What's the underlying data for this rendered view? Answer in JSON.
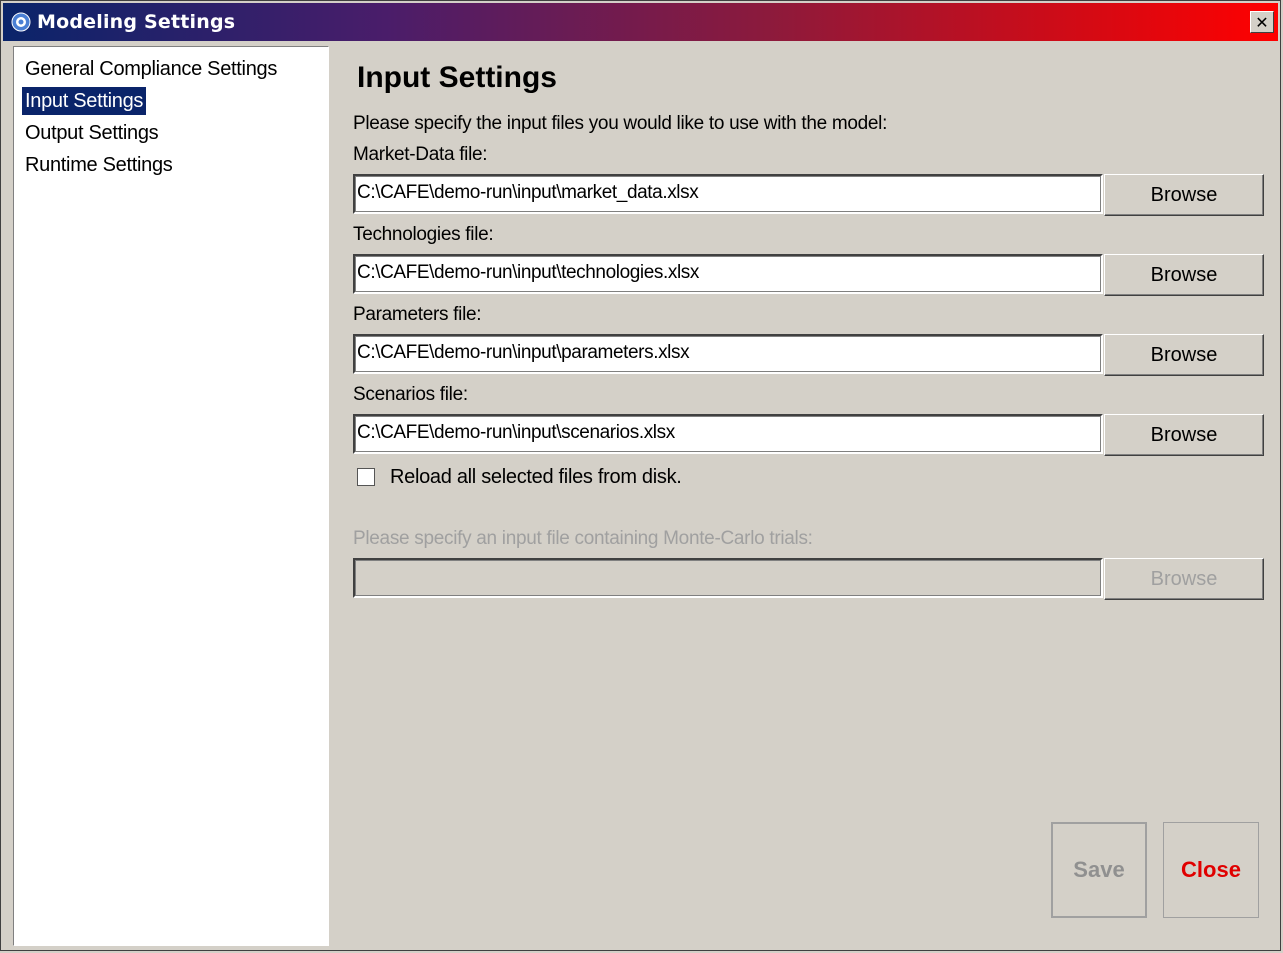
{
  "window": {
    "title": "Modeling Settings",
    "close_glyph": "✕"
  },
  "sidebar": {
    "items": [
      {
        "label": "General Compliance Settings",
        "selected": false
      },
      {
        "label": "Input Settings",
        "selected": true
      },
      {
        "label": "Output Settings",
        "selected": false
      },
      {
        "label": "Runtime Settings",
        "selected": false
      }
    ]
  },
  "main": {
    "heading": "Input Settings",
    "instruction": "Please specify the input files you would like to use with the model:",
    "files": [
      {
        "label": "Market-Data file:",
        "value": "C:\\CAFE\\demo-run\\input\\market_data.xlsx",
        "browse": "Browse"
      },
      {
        "label": "Technologies file:",
        "value": "C:\\CAFE\\demo-run\\input\\technologies.xlsx",
        "browse": "Browse"
      },
      {
        "label": "Parameters file:",
        "value": "C:\\CAFE\\demo-run\\input\\parameters.xlsx",
        "browse": "Browse"
      },
      {
        "label": "Scenarios file:",
        "value": "C:\\CAFE\\demo-run\\input\\scenarios.xlsx",
        "browse": "Browse"
      }
    ],
    "reload_checkbox": {
      "label": "Reload all selected files from disk.",
      "checked": false
    },
    "monte_carlo": {
      "label": "Please specify an input file containing Monte-Carlo trials:",
      "value": "",
      "browse": "Browse",
      "enabled": false
    }
  },
  "footer": {
    "save_label": "Save",
    "close_label": "Close"
  },
  "colors": {
    "title_gradient_start": "#0a246a",
    "title_gradient_end": "#ff0000",
    "selection": "#0a246a",
    "close_text": "#e00000",
    "disabled_text": "#a0a0a0"
  }
}
